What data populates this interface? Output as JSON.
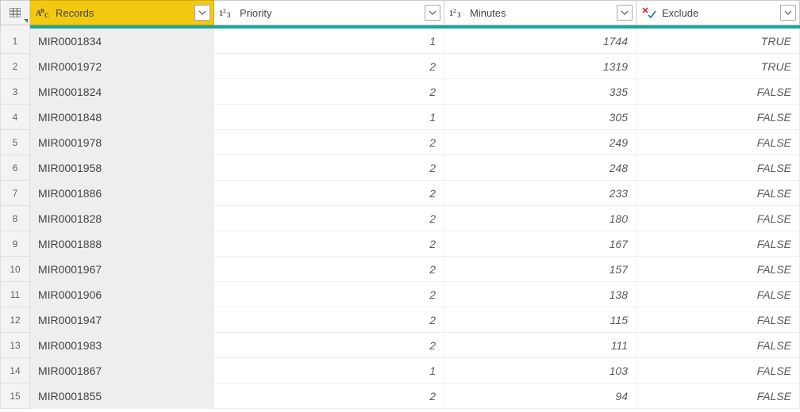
{
  "columns": [
    {
      "key": "records",
      "title": "Records",
      "type_icon": "abc",
      "selected": true
    },
    {
      "key": "priority",
      "title": "Priority",
      "type_icon": "123",
      "selected": false
    },
    {
      "key": "minutes",
      "title": "Minutes",
      "type_icon": "123",
      "selected": false
    },
    {
      "key": "exclude",
      "title": "Exclude",
      "type_icon": "bool",
      "selected": false
    }
  ],
  "rows": [
    {
      "n": "1",
      "records": "MIR0001834",
      "priority": "1",
      "minutes": "1744",
      "exclude": "TRUE"
    },
    {
      "n": "2",
      "records": "MIR0001972",
      "priority": "2",
      "minutes": "1319",
      "exclude": "TRUE"
    },
    {
      "n": "3",
      "records": "MIR0001824",
      "priority": "2",
      "minutes": "335",
      "exclude": "FALSE"
    },
    {
      "n": "4",
      "records": "MIR0001848",
      "priority": "1",
      "minutes": "305",
      "exclude": "FALSE"
    },
    {
      "n": "5",
      "records": "MIR0001978",
      "priority": "2",
      "minutes": "249",
      "exclude": "FALSE"
    },
    {
      "n": "6",
      "records": "MIR0001958",
      "priority": "2",
      "minutes": "248",
      "exclude": "FALSE"
    },
    {
      "n": "7",
      "records": "MIR0001886",
      "priority": "2",
      "minutes": "233",
      "exclude": "FALSE"
    },
    {
      "n": "8",
      "records": "MIR0001828",
      "priority": "2",
      "minutes": "180",
      "exclude": "FALSE"
    },
    {
      "n": "9",
      "records": "MIR0001888",
      "priority": "2",
      "minutes": "167",
      "exclude": "FALSE"
    },
    {
      "n": "10",
      "records": "MIR0001967",
      "priority": "2",
      "minutes": "157",
      "exclude": "FALSE"
    },
    {
      "n": "11",
      "records": "MIR0001906",
      "priority": "2",
      "minutes": "138",
      "exclude": "FALSE"
    },
    {
      "n": "12",
      "records": "MIR0001947",
      "priority": "2",
      "minutes": "115",
      "exclude": "FALSE"
    },
    {
      "n": "13",
      "records": "MIR0001983",
      "priority": "2",
      "minutes": "111",
      "exclude": "FALSE"
    },
    {
      "n": "14",
      "records": "MIR0001867",
      "priority": "1",
      "minutes": "103",
      "exclude": "FALSE"
    },
    {
      "n": "15",
      "records": "MIR0001855",
      "priority": "2",
      "minutes": "94",
      "exclude": "FALSE"
    }
  ]
}
